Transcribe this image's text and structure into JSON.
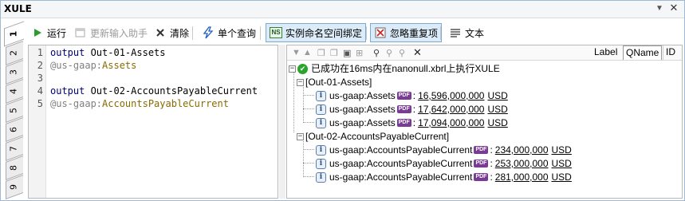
{
  "window": {
    "title": "XULE"
  },
  "tabs": [
    {
      "label": "1",
      "active": true
    },
    {
      "label": "2"
    },
    {
      "label": "3"
    },
    {
      "label": "4"
    },
    {
      "label": "5"
    },
    {
      "label": "6"
    },
    {
      "label": "7"
    },
    {
      "label": "8"
    },
    {
      "label": "9"
    }
  ],
  "toolbar": {
    "run_label": "运行",
    "update_helper_label": "更新输入助手",
    "clear_label": "清除",
    "single_query_label": "单个查询",
    "ns_badge": "NS",
    "instance_ns_label": "实例命名空间绑定",
    "ignore_dup_label": "忽略重复项",
    "text_label": "文本"
  },
  "editor": {
    "lines": [
      {
        "num": "1",
        "kw": "output",
        "rest": " Out-01-Assets"
      },
      {
        "num": "2",
        "prefix": "@us-gaap:",
        "name": "Assets"
      },
      {
        "num": "3"
      },
      {
        "num": "4",
        "kw": "output",
        "rest": " Out-02-AccountsPayableCurrent"
      },
      {
        "num": "5",
        "prefix": "@us-gaap:",
        "name": "AccountsPayableCurrent"
      }
    ]
  },
  "results": {
    "view_tabs": [
      "Label",
      "QName",
      "ID"
    ],
    "selected_view": "QName",
    "status": "已成功在16ms内在nanonull.xbrl上执行XULE",
    "groups": [
      {
        "name": "[Out-01-Assets]",
        "items": [
          {
            "concept": "us-gaap:Assets",
            "value": "16,596,000,000",
            "unit": "USD"
          },
          {
            "concept": "us-gaap:Assets",
            "value": "17,642,000,000",
            "unit": "USD"
          },
          {
            "concept": "us-gaap:Assets",
            "value": "17,094,000,000",
            "unit": "USD"
          }
        ]
      },
      {
        "name": "[Out-02-AccountsPayableCurrent]",
        "items": [
          {
            "concept": "us-gaap:AccountsPayableCurrent",
            "value": "234,000,000",
            "unit": "USD"
          },
          {
            "concept": "us-gaap:AccountsPayableCurrent",
            "value": "253,000,000",
            "unit": "USD"
          },
          {
            "concept": "us-gaap:AccountsPayableCurrent",
            "value": "281,000,000",
            "unit": "USD"
          }
        ]
      }
    ],
    "badge": "PDF",
    "colon": ":"
  },
  "colors": {
    "accent": "#2aa52a",
    "pressed_bg": "#dcebf8",
    "pdf_badge": "#7a3b96"
  }
}
